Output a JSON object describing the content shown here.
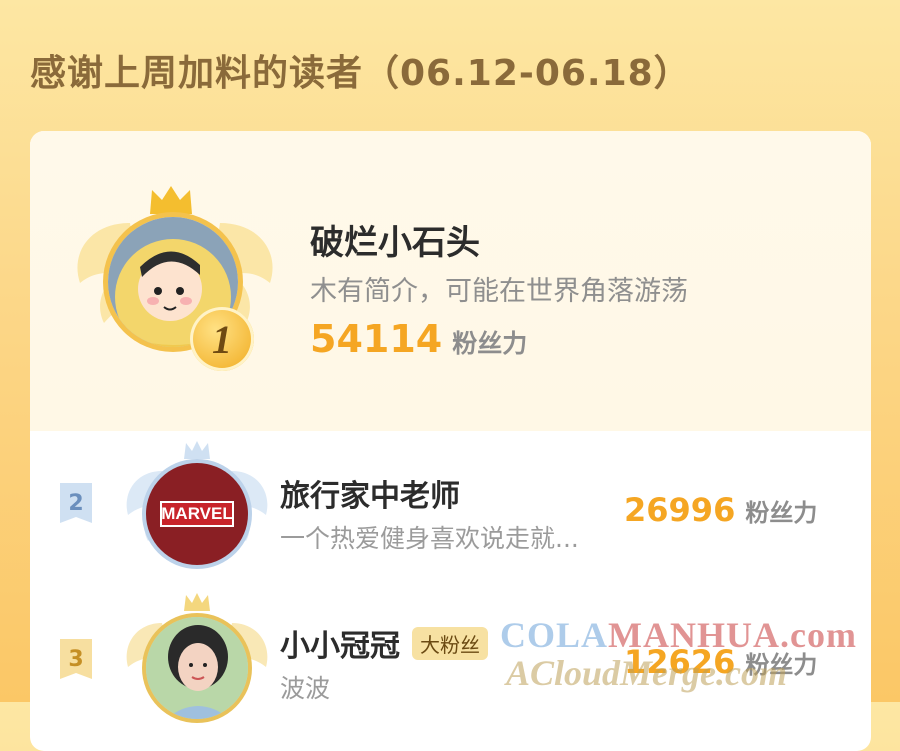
{
  "header": {
    "title": "感谢上周加料的读者（06.12-06.18）"
  },
  "rank1": {
    "rank": "1",
    "name": "破烂小石头",
    "intro": "木有简介，可能在世界角落游荡",
    "score": "54114",
    "score_label": "粉丝力"
  },
  "rank2": {
    "rank": "2",
    "name": "旅行家中老师",
    "intro": "一个热爱健身喜欢说走就...",
    "score": "26996",
    "score_label": "粉丝力",
    "avatar_text": "MARVEL"
  },
  "rank3": {
    "rank": "3",
    "name": "小小冠冠",
    "badge": "大粉丝",
    "intro": "波波",
    "score": "12626",
    "score_label": "粉丝力"
  },
  "watermark": {
    "line1_a": "COLA",
    "line1_b": "MANHUA.com",
    "line2": "ACloudMerge.com"
  },
  "colors": {
    "accent": "#f5a623",
    "background": "#fcd88a",
    "muted": "#8d8d8d"
  }
}
